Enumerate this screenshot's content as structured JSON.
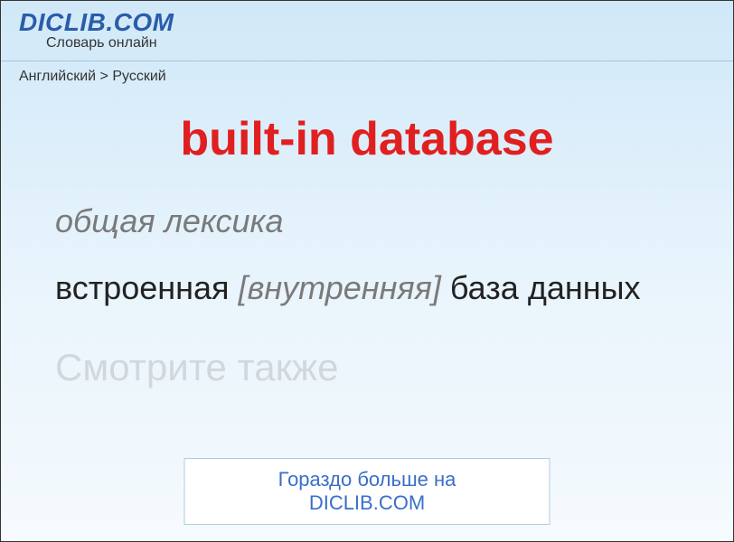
{
  "header": {
    "logo": "DICLIB.COM",
    "subtitle": "Словарь онлайн"
  },
  "breadcrumb": {
    "from": "Английский",
    "separator": ">",
    "to": "Русский"
  },
  "entry": {
    "title": "built-in database",
    "category": "общая лексика",
    "definition_prefix": "встроенная ",
    "definition_bracket": "[внутренняя]",
    "definition_suffix": " база данных",
    "see_also": "Смотрите также"
  },
  "cta": {
    "label": "Гораздо больше на DICLIB.COM"
  }
}
